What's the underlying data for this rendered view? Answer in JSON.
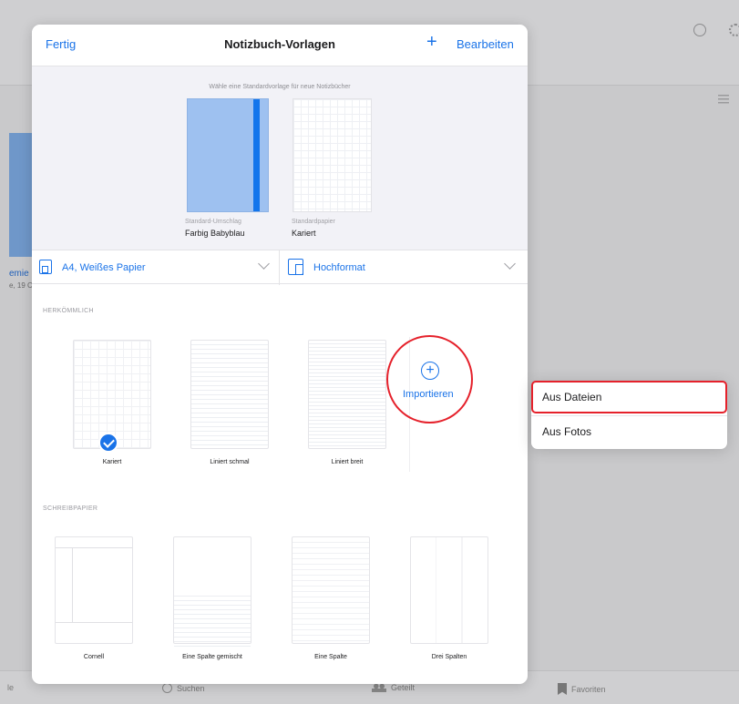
{
  "background": {
    "side_text_1": "emie",
    "side_text_2": "e, 19 C",
    "tabs": [
      {
        "label": "le"
      },
      {
        "label": "Suchen"
      },
      {
        "label": "Geteilt"
      },
      {
        "label": "Favoriten"
      }
    ]
  },
  "sheet": {
    "title": "Notizbuch-Vorlagen",
    "done_label": "Fertig",
    "add_label": "+",
    "edit_label": "Bearbeiten",
    "defaults": {
      "hint": "Wähle eine Standardvorlage für neue Notizbücher",
      "cover_caption": "Standard-Umschlag",
      "cover_value": "Farbig Babyblau",
      "paper_caption": "Standardpapier",
      "paper_value": "Kariert"
    },
    "format": {
      "size_label": "A4, Weißes Papier",
      "orientation_label": "Hochformat"
    },
    "section_classic": "HERKÖMMLICH",
    "classic_templates": [
      {
        "label": "Kariert",
        "selected": true
      },
      {
        "label": "Liniert schmal"
      },
      {
        "label": "Liniert breit"
      }
    ],
    "import_label": "Importieren",
    "section_writing": "SCHREIBPAPIER",
    "writing_templates": [
      {
        "label": "Cornell"
      },
      {
        "label": "Eine Spalte gemischt"
      },
      {
        "label": "Eine Spalte"
      },
      {
        "label": "Drei Spalten"
      }
    ]
  },
  "popover": {
    "items": [
      {
        "label": "Aus Dateien"
      },
      {
        "label": "Aus Fotos"
      }
    ]
  },
  "colors": {
    "accent": "#1a73e8",
    "highlight": "#e5212b",
    "cover": "#9ec1f0"
  }
}
